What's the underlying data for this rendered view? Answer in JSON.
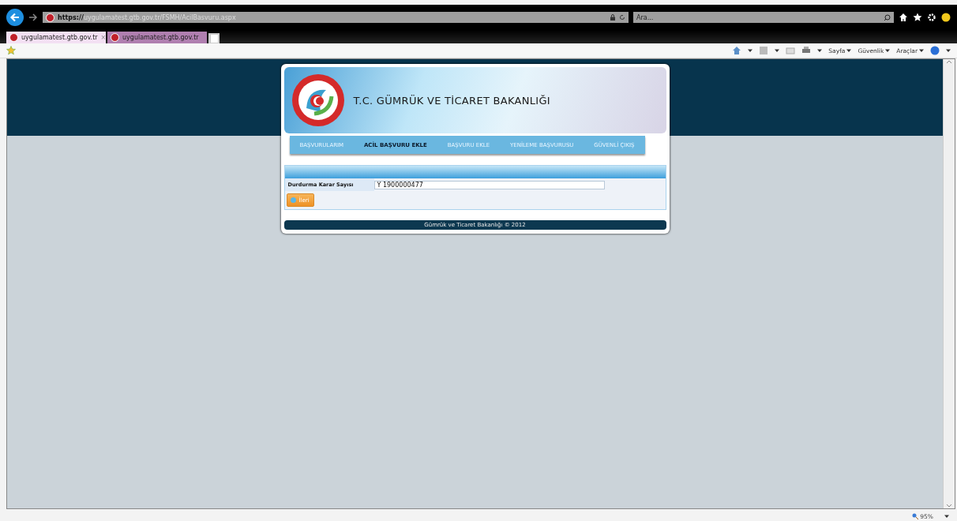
{
  "browser": {
    "address": {
      "scheme": "https://",
      "host": "uygulamatest.gtb.gov.tr",
      "path": "/FSMH/AcilBasvuru.aspx"
    },
    "search": {
      "placeholder": "Ara..."
    },
    "tabs": [
      {
        "label": "uygulamatest.gtb.gov.tr",
        "selected": true,
        "close": "×"
      },
      {
        "label": "uygulamatest.gtb.gov.tr",
        "selected": false
      }
    ],
    "commands": [
      "Sayfa",
      "Güvenlik",
      "Araçlar"
    ],
    "zoom": "95%"
  },
  "header": {
    "title": "T.C. GÜMRÜK VE TİCARET BAKANLIĞI"
  },
  "nav": [
    {
      "label": "BAŞVURULARIM",
      "selected": false
    },
    {
      "label": "ACİL BAŞVURU EKLE",
      "selected": true
    },
    {
      "label": "BAŞVURU EKLE",
      "selected": false
    },
    {
      "label": "YENİLEME BAŞVURUSU",
      "selected": false
    },
    {
      "label": "GÜVENLİ ÇIKIŞ",
      "selected": false
    }
  ],
  "form": {
    "field_label": "Durdurma Karar Sayısı",
    "field_value": "Y 1900000477",
    "button": "İleri"
  },
  "footer": "Gümrük ve Ticaret Bakanlığı © 2012"
}
